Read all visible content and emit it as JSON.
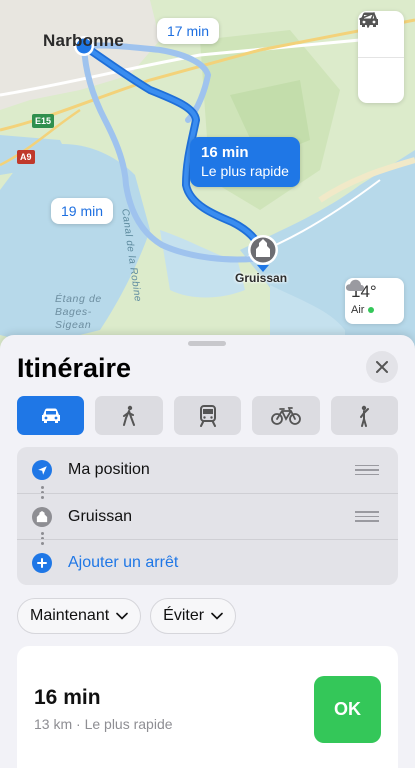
{
  "map": {
    "city": "Narbonne",
    "destination_label": "Gruissan",
    "lake_label_line1": "Étang de",
    "lake_label_line2": "Bages-",
    "lake_label_line3": "Sigean",
    "canal_label": "Canal de la Robine",
    "road_badges": {
      "e15": "E15",
      "a9": "A9"
    },
    "callouts": {
      "alt1": "17 min",
      "alt2": "19 min",
      "fastest_time": "16 min",
      "fastest_label": "Le plus rapide"
    },
    "controls": [
      "car-icon",
      "location-arrow-icon"
    ],
    "weather": {
      "temp": "14°",
      "air": "Air",
      "icon": "cloud-icon",
      "air_color": "#34c759"
    }
  },
  "sheet": {
    "title": "Itinéraire",
    "modes": [
      "car",
      "walk",
      "transit",
      "bike",
      "rideshare"
    ],
    "active_mode": "car",
    "stops": [
      {
        "label": "Ma position",
        "icon": "location-arrow-icon"
      },
      {
        "label": "Gruissan",
        "icon": "landmark-icon"
      },
      {
        "label": "Ajouter un arrêt",
        "icon": "plus-icon"
      }
    ],
    "chips": {
      "time": "Maintenant",
      "avoid": "Éviter"
    },
    "route": {
      "time": "16 min",
      "details": "13 km · Le plus rapide",
      "go_label": "OK"
    }
  },
  "colors": {
    "accent": "#1f77e6",
    "go": "#34c759"
  }
}
